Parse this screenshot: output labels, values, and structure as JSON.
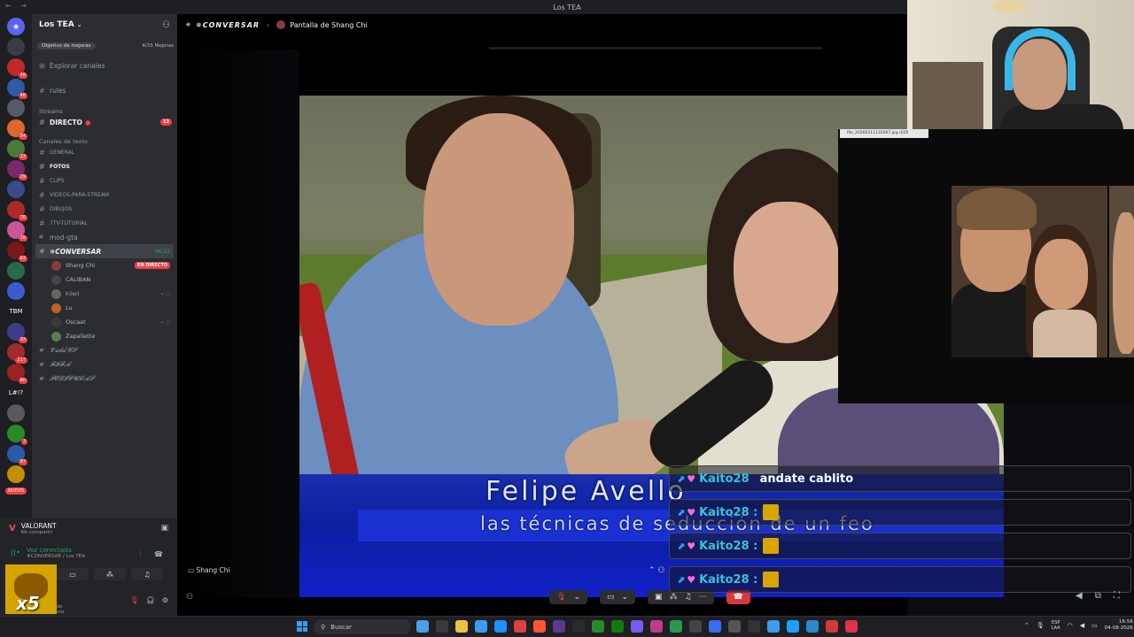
{
  "window": {
    "title": "Los TEA"
  },
  "rail": {
    "servers": [
      {
        "color": "#3b3d44",
        "badge": ""
      },
      {
        "color": "#c0282e",
        "badge": "46"
      },
      {
        "color": "#2b5da8",
        "badge": "48"
      },
      {
        "color": "#555a66",
        "badge": ""
      },
      {
        "color": "#e0662a",
        "badge": "94"
      },
      {
        "color": "#4a7a3a",
        "badge": "13"
      },
      {
        "color": "#7a2a6a",
        "badge": "29"
      },
      {
        "color": "#3a4a8a",
        "badge": ""
      },
      {
        "color": "#aa2a2a",
        "badge": "76"
      },
      {
        "color": "#cc5599",
        "badge": "16"
      },
      {
        "color": "#7a1a1a",
        "badge": "63"
      },
      {
        "color": "#2a6a4a",
        "badge": ""
      },
      {
        "color": "#3b5bd0",
        "badge": ""
      },
      {
        "color": "#222222",
        "badge": ""
      },
      {
        "color": "#3b3d8a",
        "badge": "33"
      },
      {
        "color": "#a32a2a",
        "badge": "217"
      },
      {
        "color": "#992222",
        "badge": "80"
      },
      {
        "color": "#444",
        "badge": ""
      },
      {
        "color": "#5a5a5a",
        "badge": ""
      },
      {
        "color": "#2a8a2a",
        "badge": "3"
      },
      {
        "color": "#2a5aaa",
        "badge": "97"
      },
      {
        "color": "#c09000",
        "badge": ""
      }
    ],
    "tbm_label": "TBM",
    "lh_label": "L#!?",
    "new_label": "NUEVO"
  },
  "sidebar": {
    "guild_name": "Los TEA",
    "boost_label": "Objetivo de mejoras",
    "boost_count": "4/33 Mejoras",
    "explore": "Explorar canales",
    "rules": "rules",
    "streams_cat": "Streams",
    "directo": "DIRECTO",
    "directo_badge": "12",
    "text_cat": "Canales de texto",
    "channels": [
      "GENERAL",
      "FOTOS",
      "CLIPS",
      "VIDEOS-PARA-STREAM",
      "DIBUJOS",
      "7TV-TUTORIAL",
      "mod-gta"
    ],
    "voice_channel": "✵CONVERSAR",
    "voice_time": "46:23",
    "voice_users": [
      {
        "name": "Shang Chi",
        "tag": "EN DIRECTO",
        "color": "#8b3a3a"
      },
      {
        "name": "CALIBAN",
        "tag": "",
        "color": "#444"
      },
      {
        "name": "𝕂𝕚𝕨𝕚",
        "tag": "",
        "color": "#666"
      },
      {
        "name": "Lu",
        "tag": "",
        "color": "#c0602a"
      },
      {
        "name": "Oscaat",
        "tag": "",
        "color": "#3a3a3a"
      },
      {
        "name": "Zapallette",
        "tag": "",
        "color": "#5a7a5a"
      }
    ],
    "other_channels": [
      "𝓥𝓪𝓵𝓸/𝓒𝓢",
      "𝓕𝓘𝓕𝓐",
      "𝓟𝓔𝓛𝓘𝓒𝓤𝓛𝓐𝓢"
    ]
  },
  "userpanel": {
    "activity_title": "VALORANT",
    "activity_sub": "No compartir",
    "voice_status": "Voz conectada",
    "voice_location": "✵CONVERSAR / Los TEA",
    "username_frag": "de voz",
    "x5": "x5"
  },
  "stream": {
    "channel": "✵CONVERSAR",
    "screen_of": "Pantalla de Shang Chi",
    "bottom_label": "Shang Chi",
    "lower_third_name": "Felipe Avello",
    "lower_third_sub": "las técnicas de seducción de un feo"
  },
  "chat": [
    {
      "user": "Kaito28",
      "text": "andate cablito",
      "emote": false
    },
    {
      "user": "Kaito28 :",
      "text": "",
      "emote": true
    },
    {
      "user": "Kaito28 :",
      "text": "",
      "emote": true
    },
    {
      "user": "Kaito28 :",
      "text": "",
      "emote": true
    }
  ],
  "image_window": {
    "filename": "file_20260211132007.jpg (626"
  },
  "taskbar": {
    "search_placeholder": "Buscar",
    "lang_top": "ESP",
    "lang_bottom": "LAA",
    "time": "16:56",
    "date": "04-08-2026",
    "apps": [
      "#4aa0e8",
      "#3a3a3a",
      "#f0c040",
      "#3b9cf0",
      "#1e90ff",
      "#e04040",
      "#ff5533",
      "#5a3a8a",
      "#2a2a2a",
      "#2a8a2a",
      "#107c10",
      "#7a5af0",
      "#c03a8a",
      "#2a9a4a",
      "#444",
      "#3b6cf0",
      "#555",
      "#333",
      "#3b9cf0",
      "#1ea0ff",
      "#2a8ad0",
      "#d03a3a",
      "#e0304a"
    ]
  }
}
